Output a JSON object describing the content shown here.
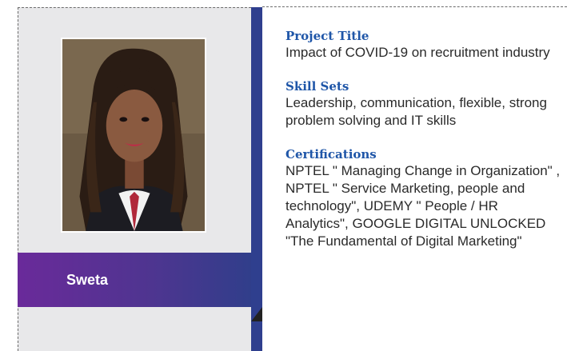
{
  "profile": {
    "name": "Sweta"
  },
  "sections": [
    {
      "heading": "Project Title",
      "body": "Impact of COVID-19 on recruitment industry"
    },
    {
      "heading": "Skill Sets",
      "body": "Leadership, communication, flexible, strong problem solving and IT skills"
    },
    {
      "heading": "Certifications",
      "body": "NPTEL \" Managing Change in Organization\" , NPTEL \" Service Marketing, people and technology\", UDEMY \" People / HR Analytics\", GOOGLE DIGITAL UNLOCKED \"The Fundamental of Digital Marketing\""
    }
  ],
  "colors": {
    "heading": "#1f56a8",
    "divider": "#2f3f8e",
    "banner_start": "#6a2a9a",
    "banner_end": "#2d3f8a"
  }
}
